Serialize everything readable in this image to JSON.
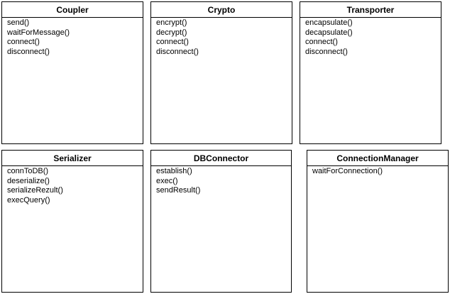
{
  "classes": [
    {
      "name": "Coupler",
      "methods": [
        "send()",
        "waitForMessage()",
        "connect()",
        "disconnect()"
      ]
    },
    {
      "name": "Crypto",
      "methods": [
        "encrypt()",
        "decrypt()",
        "connect()",
        "disconnect()"
      ]
    },
    {
      "name": "Transporter",
      "methods": [
        "encapsulate()",
        "decapsulate()",
        "connect()",
        "disconnect()"
      ]
    },
    {
      "name": "Serializer",
      "methods": [
        "connToDB()",
        "deserialize()",
        "serializeRezult()",
        "execQuery()"
      ]
    },
    {
      "name": "DBConnector",
      "methods": [
        "establish()",
        "exec()",
        "sendResult()"
      ]
    },
    {
      "name": "ConnectionManager",
      "methods": [
        "waitForConnection()"
      ]
    }
  ]
}
